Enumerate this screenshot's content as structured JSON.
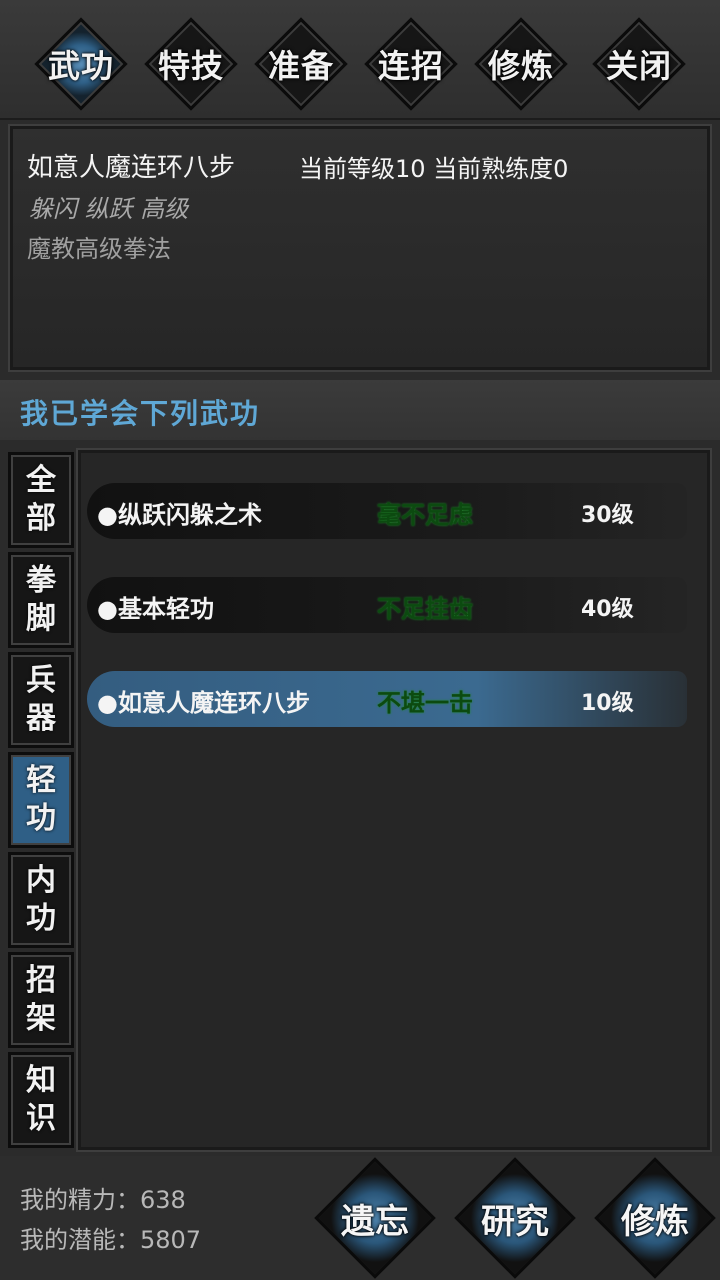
{
  "tabs": [
    {
      "label": "武功",
      "active": true
    },
    {
      "label": "特技",
      "active": false
    },
    {
      "label": "准备",
      "active": false
    },
    {
      "label": "连招",
      "active": false
    },
    {
      "label": "修炼",
      "active": false
    },
    {
      "label": "关闭",
      "active": false
    }
  ],
  "info": {
    "name": "如意人魔连环八步",
    "level_text": "当前等级10  当前熟练度0",
    "tags": "躲闪 纵跃 高级",
    "desc": "魔教高级拳法"
  },
  "section_title": "我已学会下列武功",
  "categories": [
    {
      "c1": "全",
      "c2": "部"
    },
    {
      "c1": "拳",
      "c2": "脚"
    },
    {
      "c1": "兵",
      "c2": "器"
    },
    {
      "c1": "轻",
      "c2": "功"
    },
    {
      "c1": "内",
      "c2": "功"
    },
    {
      "c1": "招",
      "c2": "架"
    },
    {
      "c1": "知",
      "c2": "识"
    }
  ],
  "active_category": 3,
  "skills": [
    {
      "name": "●纵跃闪躲之术",
      "grade": "毫不足虑",
      "level": "30级"
    },
    {
      "name": "●基本轻功",
      "grade": "不足挂齿",
      "level": "40级"
    },
    {
      "name": "●如意人魔连环八步",
      "grade": "不堪一击",
      "level": "10级"
    }
  ],
  "selected_skill": 2,
  "stats": {
    "energy": "我的精力：638",
    "potential": "我的潜能：5807"
  },
  "buttons": {
    "forget": "遗忘",
    "research": "研究",
    "practice": "修炼"
  },
  "colors": {
    "accent_blue": "#2f5f86",
    "section_title": "#5fa8d6",
    "grade_green": "#0c4a10"
  }
}
